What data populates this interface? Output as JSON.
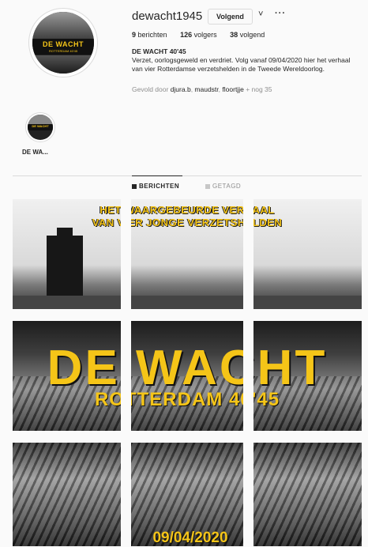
{
  "profile": {
    "username": "dewacht1945",
    "follow_label": "Volgend",
    "chevron_glyph": "˅",
    "more_glyph": "···",
    "stats": {
      "posts_count": "9",
      "posts_label": "berichten",
      "followers_count": "126",
      "followers_label": "volgers",
      "following_count": "38",
      "following_label": "volgend"
    },
    "full_name": "DE WACHT 40'45",
    "bio": "Verzet, oorlogsgeweld en verdriet. Volg vanaf 09/04/2020 hier het verhaal van vier Rotterdamse verzetshelden in de Tweede Wereldoorlog.",
    "followed_by_prefix": "Gevold door",
    "followed_by_users": [
      "djura.b",
      "maudstr",
      "floortjje"
    ],
    "followed_by_more": "+ nog 35",
    "avatar_text": "DE WACHT",
    "avatar_sub": "ROTTERDAM 40'45"
  },
  "highlight": {
    "label": "DE WA...",
    "circle_text": "DE WACHT"
  },
  "tabs": {
    "posts_label": "BERICHTEN",
    "tagged_label": "GETAGD",
    "icons": [
      "grid-icon",
      "tag-icon"
    ]
  },
  "grid": {
    "overlay_line1": "HET WAARGEBEURDE VERHAAL",
    "overlay_line2": "VAN VIER JONGE VERZETSHELDEN",
    "overlay_big": "DE WACHT",
    "overlay_mid": "ROTTERDAM 40'45",
    "overlay_date": "09/04/2020"
  },
  "colors": {
    "accent_yellow": "#f5c518",
    "background": "#fafafa",
    "text": "#262626",
    "muted": "#8e8e8e"
  }
}
